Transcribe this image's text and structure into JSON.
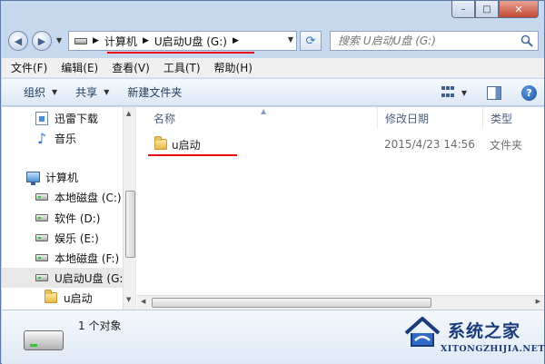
{
  "window": {
    "caption": {
      "minimize": "–",
      "maximize": "□",
      "close": "✕"
    }
  },
  "address": {
    "crumbs": [
      "计算机",
      "U启动U盘 (G:)"
    ],
    "search_placeholder": "搜索 U启动U盘 (G:)"
  },
  "menu": [
    "文件(F)",
    "编辑(E)",
    "查看(V)",
    "工具(T)",
    "帮助(H)"
  ],
  "toolbar": {
    "organize": "组织",
    "share": "共享",
    "new_folder": "新建文件夹",
    "help": "?"
  },
  "nav": {
    "items": [
      {
        "label": "迅雷下载",
        "icon": "download-folder-icon"
      },
      {
        "label": "音乐",
        "icon": "music-icon"
      },
      {
        "label": "计算机",
        "icon": "computer-icon"
      },
      {
        "label": "本地磁盘 (C:)",
        "icon": "drive-icon"
      },
      {
        "label": "软件 (D:)",
        "icon": "drive-icon"
      },
      {
        "label": "娱乐 (E:)",
        "icon": "drive-icon"
      },
      {
        "label": "本地磁盘 (F:)",
        "icon": "drive-icon"
      },
      {
        "label": "U启动U盘 (G:)",
        "icon": "usb-drive-icon",
        "selected": true
      },
      {
        "label": "u启动",
        "icon": "folder-icon"
      }
    ]
  },
  "columns": {
    "name": "名称",
    "date": "修改日期",
    "type": "类型"
  },
  "files": [
    {
      "name": "u启动",
      "date": "2015/4/23 14:56",
      "type": "文件夹"
    }
  ],
  "status": {
    "count": "1 个对象"
  },
  "watermark": {
    "name": "系统之家",
    "url": "XITONGZHIJIA.NET"
  }
}
